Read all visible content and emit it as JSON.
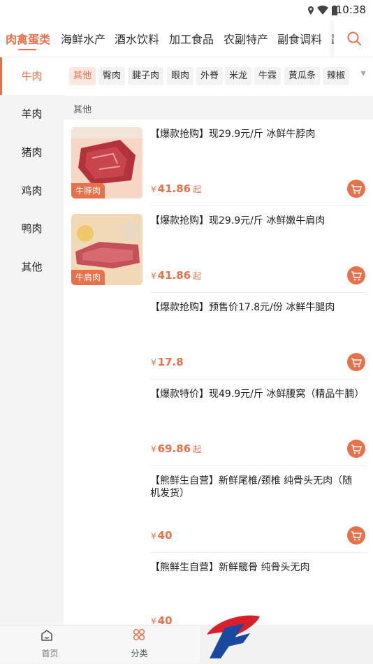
{
  "status_bar": {
    "time": "10:38"
  },
  "top_tabs": [
    {
      "label": "肉禽蛋类",
      "active": true
    },
    {
      "label": "海鲜水产"
    },
    {
      "label": "酒水饮料"
    },
    {
      "label": "加工食品"
    },
    {
      "label": "农副特产"
    },
    {
      "label": "副食调料"
    },
    {
      "label": "蔬"
    }
  ],
  "sidebar": {
    "items": [
      {
        "label": "牛肉",
        "active": true
      },
      {
        "label": "羊肉"
      },
      {
        "label": "猪肉"
      },
      {
        "label": "鸡肉"
      },
      {
        "label": "鸭肉"
      },
      {
        "label": "其他"
      }
    ]
  },
  "sub_tabs": [
    {
      "label": "其他",
      "active": true
    },
    {
      "label": "臀肉"
    },
    {
      "label": "腱子肉"
    },
    {
      "label": "眼肉"
    },
    {
      "label": "外脊"
    },
    {
      "label": "米龙"
    },
    {
      "label": "牛霖"
    },
    {
      "label": "黄瓜条"
    },
    {
      "label": "辣椒"
    }
  ],
  "section_header": "其他",
  "products": [
    {
      "title": "【爆款抢购】现29.9元/斤 冰鲜牛脖肉",
      "currency": "¥",
      "price": "41.86",
      "suffix": "起",
      "image_label": "牛脖肉"
    },
    {
      "title": "【爆款抢购】现29.9元/斤 冰鲜嫩牛肩肉",
      "currency": "¥",
      "price": "41.86",
      "suffix": "起",
      "image_label": "牛肩肉"
    },
    {
      "title": "【爆款抢购】预售价17.8元/份 冰鲜牛腿肉",
      "currency": "¥",
      "price": "17.8",
      "suffix": ""
    },
    {
      "title": "【爆款特价】现49.9元/斤 冰鲜腰窝（精品牛腩）",
      "currency": "¥",
      "price": "69.86",
      "suffix": "起"
    },
    {
      "title": "【熊鲜生自营】新鲜尾椎/颈椎 纯骨头无肉（随机发货）",
      "currency": "¥",
      "price": "40",
      "suffix": ""
    },
    {
      "title": "【熊鲜生自营】新鲜髋骨 纯骨头无肉",
      "currency": "¥",
      "price": "40",
      "suffix": ""
    }
  ],
  "bottom_nav": [
    {
      "label": "首页",
      "icon": "home-icon"
    },
    {
      "label": "分类",
      "icon": "category-icon",
      "active": true
    }
  ],
  "colors": {
    "accent": "#e8714a",
    "logo_red": "#d9202a",
    "logo_blue": "#1a4aa0"
  }
}
